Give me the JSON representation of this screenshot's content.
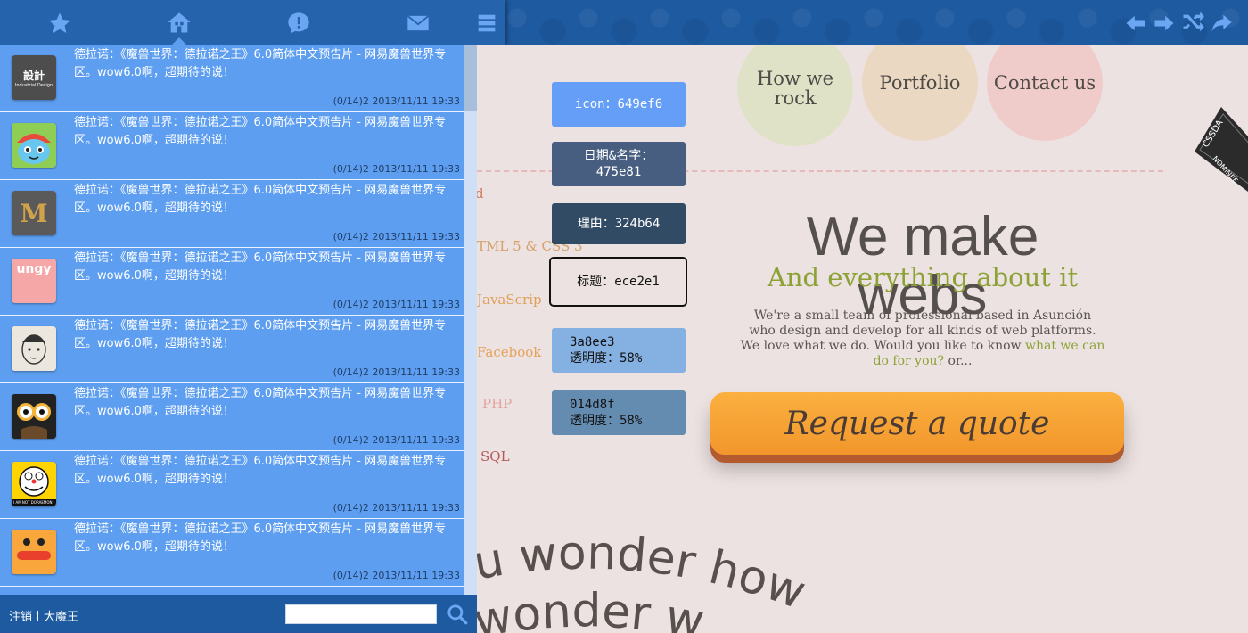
{
  "sidebar": {
    "items": [
      {
        "text": "德拉诺：《魔兽世界：德拉诺之王》6.0简体中文预告片 - 网易魔兽世界专区。wow6.0啊，超期待的说！",
        "meta": "(0/14)2 2013/11/11 19:33",
        "avatar": "design-logo-avatar",
        "logo_line1": "設計",
        "logo_line2": "Industrial Design"
      },
      {
        "text": "德拉诺：《魔兽世界：德拉诺之王》6.0简体中文预告片 - 网易魔兽世界专区。wow6.0啊，超期待的说！",
        "meta": "(0/14)2 2013/11/11 19:33",
        "avatar": "cartoon-avatar"
      },
      {
        "text": "德拉诺：《魔兽世界：德拉诺之王》6.0简体中文预告片 - 网易魔兽世界专区。wow6.0啊，超期待的说！",
        "meta": "(0/14)2 2013/11/11 19:33",
        "avatar": "m-logo-avatar",
        "logo_letter": "M"
      },
      {
        "text": "德拉诺：《魔兽世界：德拉诺之王》6.0简体中文预告片 - 网易魔兽世界专区。wow6.0啊，超期待的说！",
        "meta": "(0/14)2 2013/11/11 19:33",
        "avatar": "pink-logo-avatar",
        "logo_text": "ungy"
      },
      {
        "text": "德拉诺：《魔兽世界：德拉诺之王》6.0简体中文预告片 - 网易魔兽世界专区。wow6.0啊，超期待的说！",
        "meta": "(0/14)2 2013/11/11 19:33",
        "avatar": "sketch-avatar"
      },
      {
        "text": "德拉诺：《魔兽世界：德拉诺之王》6.0简体中文预告片 - 网易魔兽世界专区。wow6.0啊，超期待的说！",
        "meta": "(0/14)2 2013/11/11 19:33",
        "avatar": "glasses-avatar"
      },
      {
        "text": "德拉诺：《魔兽世界：德拉诺之王》6.0简体中文预告片 - 网易魔兽世界专区。wow6.0啊，超期待的说！",
        "meta": "(0/14)2 2013/11/11 19:33",
        "avatar": "doraemon-avatar",
        "logo_text": "I AM NOT DORAEMON"
      },
      {
        "text": "德拉诺：《魔兽世界：德拉诺之王》6.0简体中文预告片 - 网易魔兽世界专区。wow6.0啊，超期待的说！",
        "meta": "(0/14)2 2013/11/11 19:33",
        "avatar": "orange-face-avatar"
      }
    ]
  },
  "bottom": {
    "label": "注销丨大魔王",
    "search_value": ""
  },
  "topnav": {
    "icons": [
      "star-icon",
      "home-icon",
      "alert-icon",
      "mail-icon",
      "menu-icon"
    ],
    "right_tools": [
      "arrow-left-icon",
      "arrow-right-icon",
      "shuffle-icon",
      "share-icon"
    ]
  },
  "swatches": {
    "icon": {
      "label": "icon：649ef6",
      "color": "#649ef6"
    },
    "date_name": {
      "label1": "日期&名字：",
      "label2": "475e81",
      "color": "#475e81"
    },
    "reason": {
      "label": "理由：324b64",
      "color": "#324b64"
    },
    "title": {
      "label": "标题：ece2e1",
      "color": "#ece2e1"
    },
    "overlay1": {
      "label1": "3a8ee3",
      "label2": "透明度：58%",
      "color": "#3a8ee3"
    },
    "overlay2": {
      "label1": "014d8f",
      "label2": "透明度：58%",
      "color": "#014d8f"
    }
  },
  "preview": {
    "nav": [
      "How we rock",
      "Portfolio",
      "Contact us"
    ],
    "side_links": [
      "d",
      "TML 5 & CSS 3",
      "JavaScrip",
      "Facebook",
      "PHP",
      "SQL"
    ],
    "title": "We make webs",
    "subtitle": "And everything about it",
    "desc_part1": "We're a small team of professional based in Asunción who design and develop for all kinds of web platforms. We love what we do. Would you like to know ",
    "desc_accent": "what we can do for you?",
    "desc_part2": " or...",
    "cta": "Request a quote",
    "curve_line1": "u wonder how",
    "curve_line2": "wonder w",
    "ribbon_text1": "CSSDA",
    "ribbon_text2": "NOMINEE"
  }
}
